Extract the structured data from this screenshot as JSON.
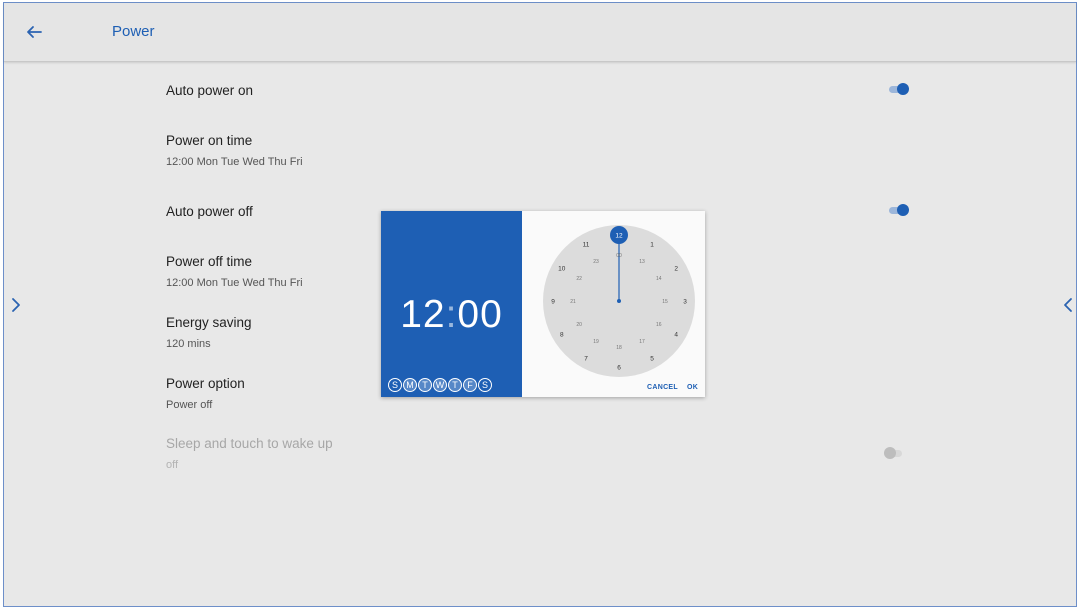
{
  "header": {
    "title": "Power",
    "back_icon": "arrow-left-icon"
  },
  "nav": {
    "left_icon": "chevron-right-icon",
    "right_icon": "chevron-left-icon"
  },
  "settings": [
    {
      "id": "auto-power-on",
      "title": "Auto power on",
      "subtitle": "",
      "toggle": true,
      "toggle_on": true,
      "enabled": true
    },
    {
      "id": "power-on-time",
      "title": "Power on time",
      "subtitle": "12:00 Mon Tue Wed Thu Fri",
      "toggle": false,
      "enabled": true
    },
    {
      "id": "auto-power-off",
      "title": "Auto power off",
      "subtitle": "",
      "toggle": true,
      "toggle_on": true,
      "enabled": true
    },
    {
      "id": "power-off-time",
      "title": "Power off time",
      "subtitle": "12:00 Mon Tue Wed Thu Fri",
      "toggle": false,
      "enabled": true
    },
    {
      "id": "energy-saving",
      "title": "Energy saving",
      "subtitle": "120 mins",
      "toggle": false,
      "enabled": true
    },
    {
      "id": "power-option",
      "title": "Power option",
      "subtitle": "Power off",
      "toggle": false,
      "enabled": true
    },
    {
      "id": "sleep-touch-wake",
      "title": "Sleep and touch to wake up",
      "subtitle": "off",
      "toggle": true,
      "toggle_on": false,
      "enabled": false
    }
  ],
  "time_picker": {
    "hour": "12",
    "minute": "00",
    "days": [
      {
        "label": "S",
        "selected": false
      },
      {
        "label": "M",
        "selected": true
      },
      {
        "label": "T",
        "selected": true
      },
      {
        "label": "W",
        "selected": true
      },
      {
        "label": "T",
        "selected": true
      },
      {
        "label": "F",
        "selected": true
      },
      {
        "label": "S",
        "selected": false
      }
    ],
    "clock_outer": [
      "12",
      "1",
      "2",
      "3",
      "4",
      "5",
      "6",
      "7",
      "8",
      "9",
      "10",
      "11"
    ],
    "clock_inner": [
      "00",
      "13",
      "14",
      "15",
      "16",
      "17",
      "18",
      "19",
      "20",
      "21",
      "22",
      "23"
    ],
    "selected_hour": "12",
    "cancel_label": "CANCEL",
    "ok_label": "OK"
  },
  "colors": {
    "accent": "#1e5fb4",
    "background": "#e8e8e8",
    "clock_face": "#dcdcdc"
  }
}
